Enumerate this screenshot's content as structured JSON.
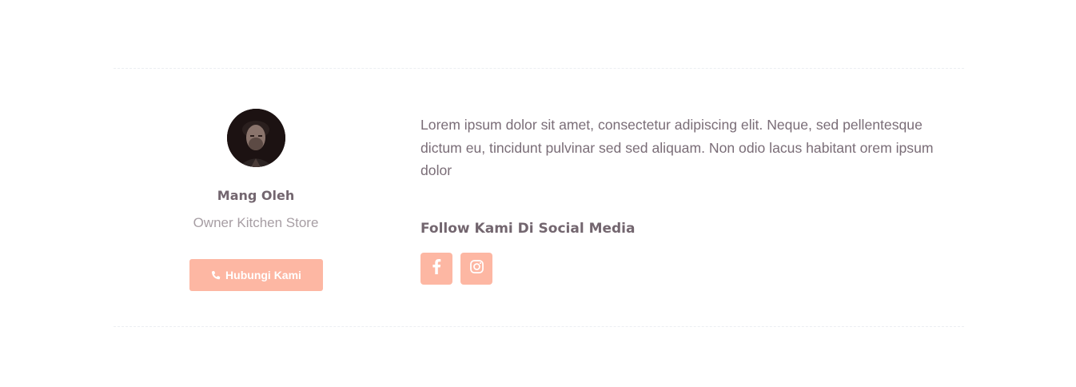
{
  "profile": {
    "name": "Mang Oleh",
    "role": "Owner Kitchen Store",
    "contact_button_label": "Hubungi Kami",
    "contact_icon": "phone-icon"
  },
  "about": {
    "description": "Lorem ipsum dolor sit amet, consectetur adipiscing elit. Neque, sed pellentesque dictum eu, tincidunt pulvinar sed sed aliquam. Non odio lacus habitant orem ipsum dolor"
  },
  "social": {
    "title": "Follow Kami Di Social Media",
    "links": [
      {
        "network": "facebook",
        "icon": "facebook-icon"
      },
      {
        "network": "instagram",
        "icon": "instagram-icon"
      }
    ]
  },
  "colors": {
    "accent": "#fdb7a3",
    "heading": "#73666f",
    "body_text": "#7a6d77",
    "muted_text": "#a79ea4",
    "divider": "#eceef2"
  }
}
